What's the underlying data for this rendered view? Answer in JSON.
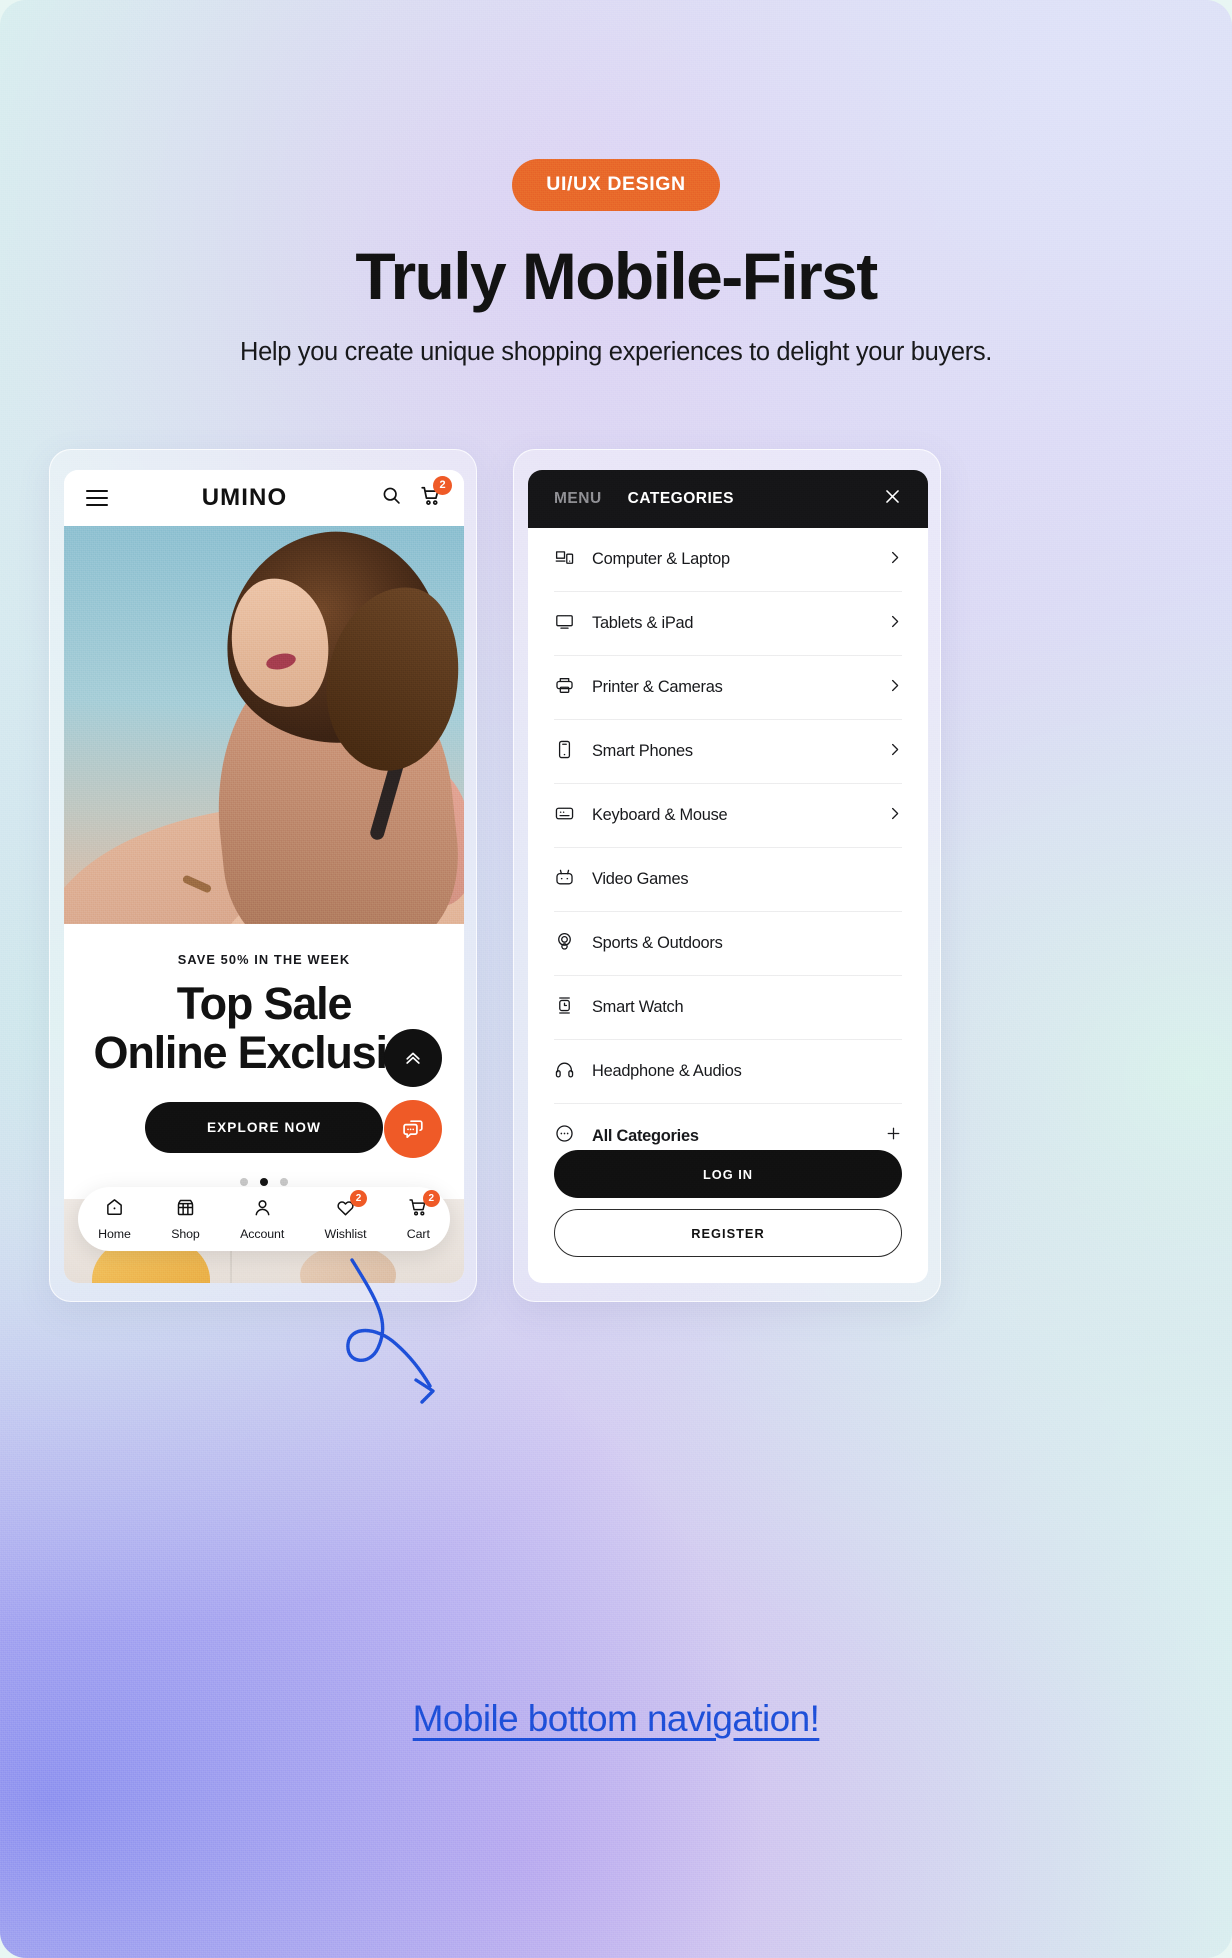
{
  "header": {
    "badge": "UI/UX DESIGN",
    "title": "Truly Mobile-First",
    "subtitle": "Help you create unique shopping experiences to delight your buyers.",
    "badge_color": "#e8672a"
  },
  "phone": {
    "appbar": {
      "menu_icon": "hamburger-icon",
      "logo": "UMINO",
      "search_icon": "search-icon",
      "cart_icon": "cart-icon",
      "cart_count": "2"
    },
    "hero": {
      "kicker": "SAVE 50% IN THE WEEK",
      "title_line1": "Top Sale",
      "title_line2": "Online Exclusive",
      "cta_label": "EXPLORE NOW",
      "carousel_dots": 3,
      "carousel_active": 2
    },
    "floating": {
      "scroll_top_icon": "chevron-double-up-icon",
      "chat_icon": "chat-bubble-icon",
      "chat_color": "#ef5a27"
    },
    "bottom_nav": [
      {
        "label": "Home",
        "icon": "home-icon",
        "badge": ""
      },
      {
        "label": "Shop",
        "icon": "shop-icon",
        "badge": ""
      },
      {
        "label": "Account",
        "icon": "user-icon",
        "badge": ""
      },
      {
        "label": "Wishlist",
        "icon": "heart-icon",
        "badge": "2"
      },
      {
        "label": "Cart",
        "icon": "cart-icon",
        "badge": "2"
      }
    ]
  },
  "menu_panel": {
    "tab_menu": "MENU",
    "tab_categories": "CATEGORIES",
    "close_icon": "close-icon",
    "categories": [
      {
        "label": "Computer & Laptop",
        "icon": "computer-laptop-icon",
        "chevron": true
      },
      {
        "label": "Tablets & iPad",
        "icon": "tablet-icon",
        "chevron": true
      },
      {
        "label": "Printer & Cameras",
        "icon": "printer-icon",
        "chevron": true
      },
      {
        "label": "Smart Phones",
        "icon": "smartphone-icon",
        "chevron": true
      },
      {
        "label": "Keyboard & Mouse",
        "icon": "keyboard-icon",
        "chevron": true
      },
      {
        "label": "Video Games",
        "icon": "game-controller-icon",
        "chevron": false
      },
      {
        "label": "Sports & Outdoors",
        "icon": "sports-icon",
        "chevron": false
      },
      {
        "label": "Smart Watch",
        "icon": "smartwatch-icon",
        "chevron": false
      },
      {
        "label": "Headphone & Audios",
        "icon": "headphone-icon",
        "chevron": false
      },
      {
        "label": "All Categories",
        "icon": "ellipsis-circle-icon",
        "chevron": false,
        "plus": true
      }
    ],
    "login_label": "LOG IN",
    "register_label": "REGISTER"
  },
  "annotation": {
    "text": "Mobile bottom navigation!",
    "color": "#1d4ed8",
    "arrow_icon": "curved-arrow-icon"
  }
}
